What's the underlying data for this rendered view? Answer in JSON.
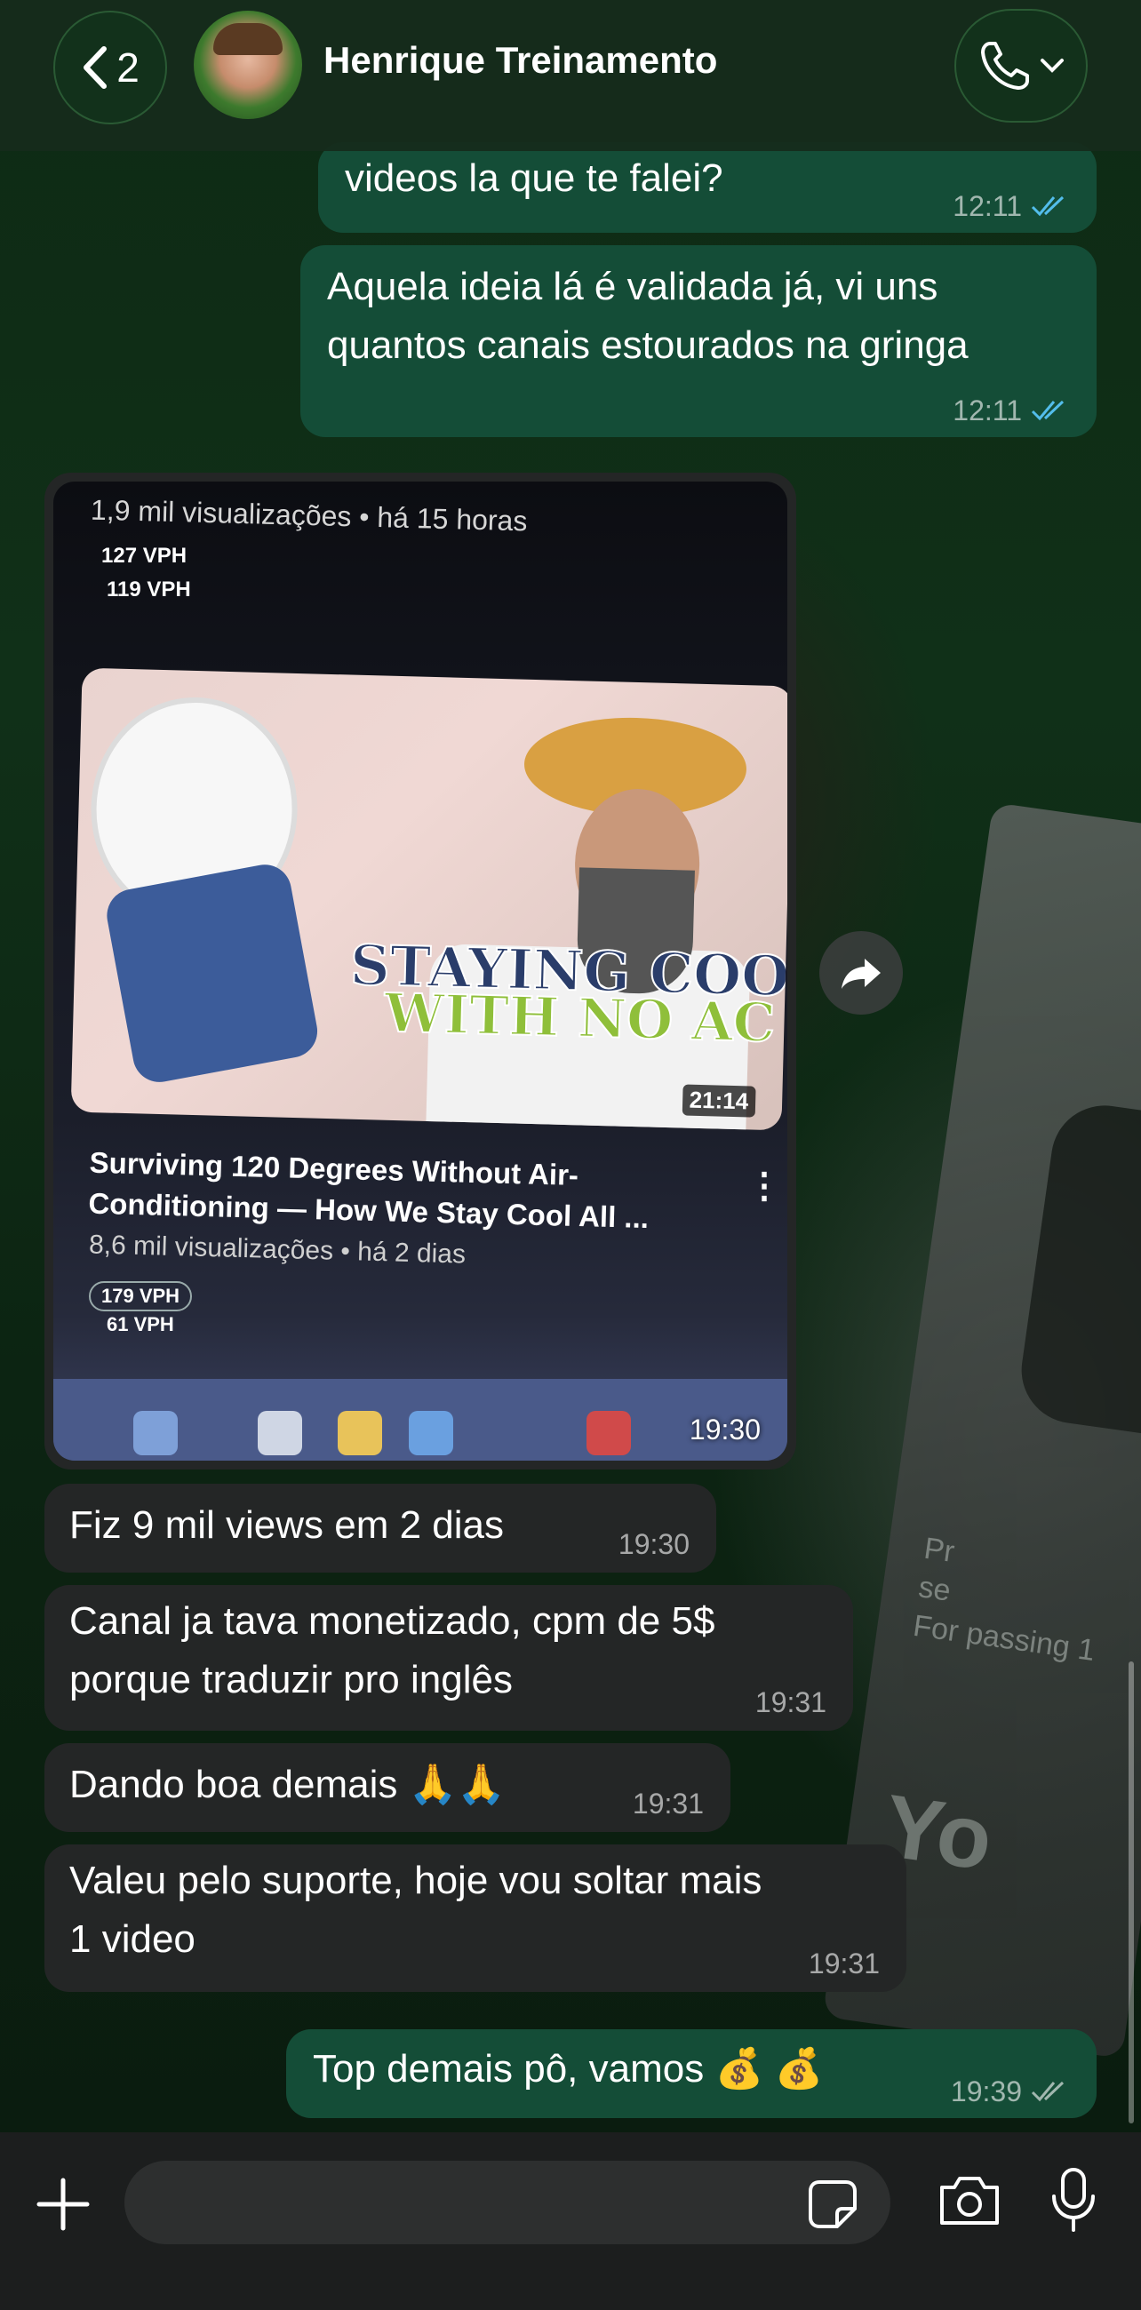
{
  "header": {
    "back_count": "2",
    "contact_name": "Henrique Treinamento"
  },
  "messages": [
    {
      "dir": "out",
      "text": "videos la que te falei?",
      "time": "12:11",
      "read": true
    },
    {
      "dir": "out",
      "lines": [
        "Aquela ideia lá é validada já, vi uns",
        "quantos canais estourados na gringa"
      ],
      "time": "12:11",
      "read": true
    },
    {
      "dir": "in",
      "type": "image",
      "time": "19:30"
    },
    {
      "dir": "in",
      "text": "Fiz 9 mil views em 2 dias",
      "time": "19:30"
    },
    {
      "dir": "in",
      "lines": [
        "Canal ja tava monetizado, cpm de 5$",
        "porque traduzir pro inglês"
      ],
      "time": "19:31"
    },
    {
      "dir": "in",
      "text": "Dando boa demais 🙏🙏",
      "time": "19:31"
    },
    {
      "dir": "in",
      "lines": [
        "Valeu pelo suporte, hoje vou soltar mais",
        "1 video"
      ],
      "time": "19:31"
    },
    {
      "dir": "out",
      "text": "Top demais pô, vamos 💰 💰",
      "time": "19:39",
      "read": false
    }
  ],
  "media": {
    "top_views": "1,9 mil visualizações • há 15 horas",
    "top_vph_1": "127 VPH",
    "top_vph_2": "119 VPH",
    "thumb_line1": "STAYING COOL",
    "thumb_line2": "WITH NO AC",
    "duration": "21:14",
    "video_title": "Surviving 120 Degrees Without Air-Conditioning — How We Stay Cool All ...",
    "video_meta": "8,6 mil visualizações • há 2 dias",
    "vph_1": "179 VPH",
    "vph_2": "61 VPH"
  },
  "wallpaper": {
    "plaque_text_1": "Pr",
    "plaque_text_2": "se",
    "plaque_text_3": "For passing 1",
    "plaque_logo": "Yo"
  },
  "colors": {
    "outgoing_bubble": "#144d37",
    "incoming_bubble": "#242626",
    "read_tick": "#53bdeb",
    "header_bg": "#162c1c"
  }
}
